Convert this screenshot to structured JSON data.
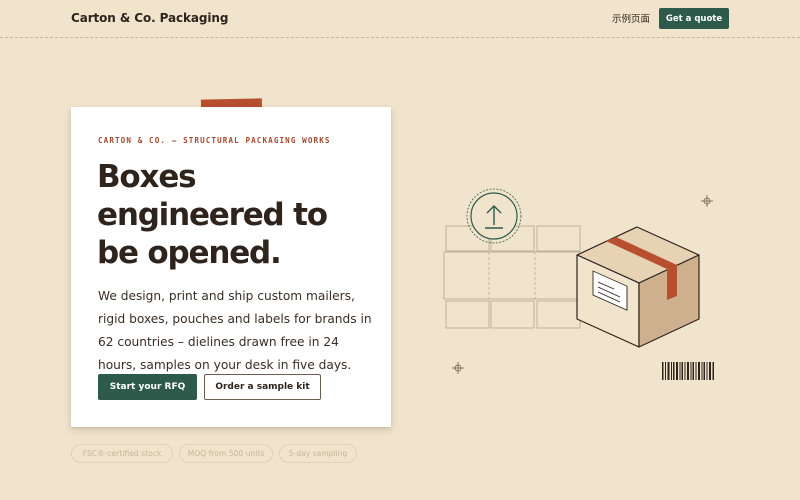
{
  "header": {
    "brand": "Carton & Co. Packaging",
    "nav_link": "示例页面",
    "cta": "Get a quote"
  },
  "hero": {
    "eyebrow": "CARTON & CO. – STRUCTURAL PACKAGING WORKS",
    "headline_lines": [
      "Boxes",
      "engineered to",
      "be opened."
    ],
    "body": "We design, print and ship custom mailers, rigid boxes, pouches and labels for brands in 62 countries – dielines drawn free in 24 hours, samples on your desk in five days.",
    "primary_button": "Start your RFQ",
    "secondary_button": "Order a sample kit"
  },
  "chips": [
    "FSC®-certified stock",
    "MOQ from 500 units",
    "5-day sampling"
  ],
  "colors": {
    "background": "#f1e4cd",
    "accent_green": "#2d5a4a",
    "accent_rust": "#b8502f",
    "text_dark": "#2f241c"
  },
  "icons": [
    "upload-icon",
    "crosshair-icon",
    "barcode-icon",
    "box-illustration",
    "dieline-illustration"
  ]
}
